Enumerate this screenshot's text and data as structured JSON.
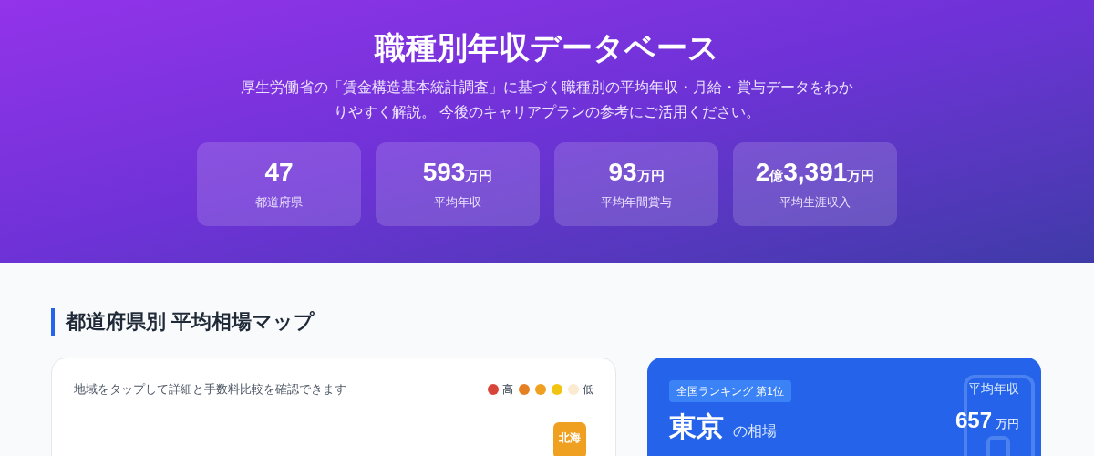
{
  "hero": {
    "title": "職種別年収データベース",
    "description": "厚生労働省の「賃金構造基本統計調査」に基づく職種別の平均年収・月給・賞与データをわかりやすく解説。 今後のキャリアプランの参考にご活用ください。",
    "stats": [
      {
        "value": [
          {
            "kind": "number",
            "text": "47"
          }
        ],
        "label": "都道府県"
      },
      {
        "value": [
          {
            "kind": "number",
            "text": "593"
          },
          {
            "kind": "unit",
            "text": "万円"
          }
        ],
        "label": "平均年収"
      },
      {
        "value": [
          {
            "kind": "number",
            "text": "93"
          },
          {
            "kind": "unit",
            "text": "万円"
          }
        ],
        "label": "平均年間賞与"
      },
      {
        "value": [
          {
            "kind": "number",
            "text": "2"
          },
          {
            "kind": "unit",
            "text": "億"
          },
          {
            "kind": "number",
            "text": "3,391"
          },
          {
            "kind": "unit",
            "text": "万円"
          }
        ],
        "label": "平均生涯収入"
      }
    ]
  },
  "section": {
    "title": "都道府県別 平均相場マップ"
  },
  "map": {
    "hint": "地域をタップして詳細と手数料比較を確認できます",
    "legend": [
      {
        "color": "#d9443a",
        "label": "高"
      },
      {
        "color": "#e67e22"
      },
      {
        "color": "#f0a020"
      },
      {
        "color": "#f1c40f"
      },
      {
        "color": "#fbe9d0",
        "label": "低"
      }
    ],
    "tiles": [
      {
        "label": "北海",
        "color": "#f0a020"
      }
    ]
  },
  "detail": {
    "badge": "全国ランキング 第1位",
    "name": "東京",
    "suffix": "の相場",
    "stat_label": "平均年収",
    "stat_value": "657",
    "stat_unit": "万円"
  }
}
